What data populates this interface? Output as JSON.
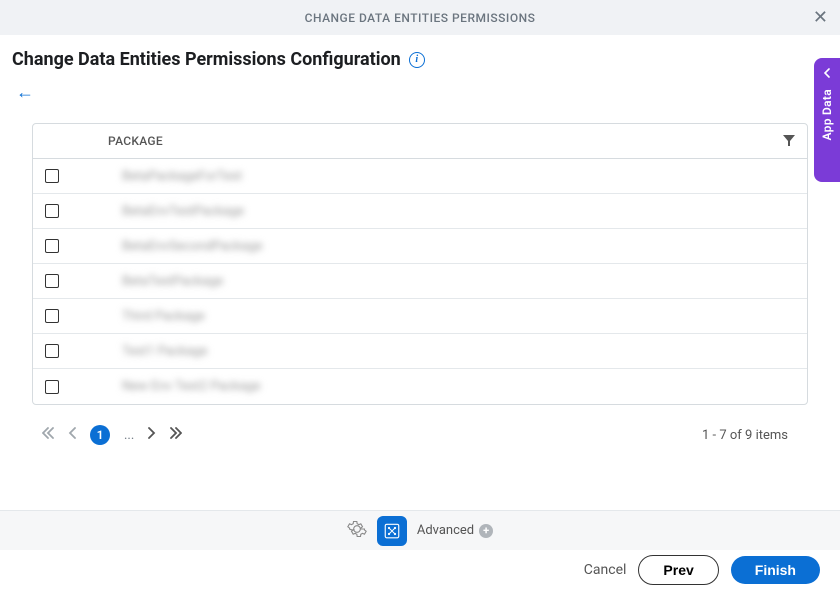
{
  "titlebar": {
    "title": "CHANGE DATA ENTITIES PERMISSIONS"
  },
  "header": {
    "page_title": "Change Data Entities Permissions Configuration"
  },
  "table": {
    "column_header": "PACKAGE",
    "rows": [
      {
        "label": "BetaPackageForTest"
      },
      {
        "label": "BetaEnvTestPackage"
      },
      {
        "label": "BetaEnvSecondPackage"
      },
      {
        "label": "BetaTestPackage"
      },
      {
        "label": "Third Package"
      },
      {
        "label": "Test1 Package"
      },
      {
        "label": "New Env Test2 Package"
      }
    ]
  },
  "pager": {
    "current_page": "1",
    "ellipsis": "...",
    "info": "1 - 7 of 9 items"
  },
  "sidetab": {
    "label": "App Data"
  },
  "toolbar": {
    "advanced_label": "Advanced"
  },
  "footer": {
    "cancel": "Cancel",
    "prev": "Prev",
    "finish": "Finish"
  }
}
